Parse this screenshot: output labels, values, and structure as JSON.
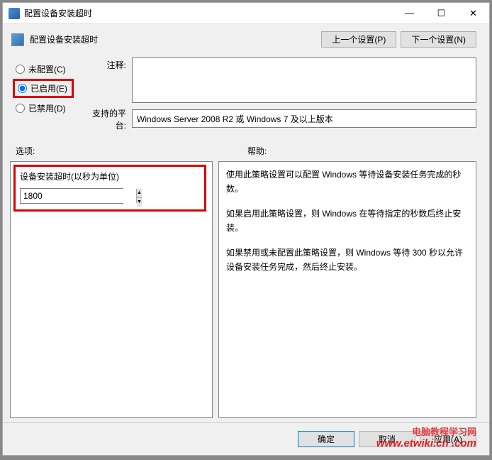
{
  "window": {
    "title": "配置设备安装超时"
  },
  "header": {
    "title": "配置设备安装超时",
    "prev": "上一个设置(P)",
    "next": "下一个设置(N)"
  },
  "radios": {
    "not_configured": "未配置(C)",
    "enabled": "已启用(E)",
    "disabled": "已禁用(D)"
  },
  "labels": {
    "comment": "注释:",
    "platform": "支持的平台:",
    "options": "选项:",
    "help": "帮助:"
  },
  "fields": {
    "comment_value": "",
    "platform_value": "Windows Server 2008 R2 或 Windows 7 及以上版本"
  },
  "options": {
    "timeout_label": "设备安装超时(以秒为单位)",
    "timeout_value": "1800"
  },
  "help": {
    "p1": "使用此策略设置可以配置 Windows 等待设备安装任务完成的秒数。",
    "p2": "如果启用此策略设置，则 Windows 在等待指定的秒数后终止安装。",
    "p3": "如果禁用或未配置此策略设置，则 Windows 等待 300 秒以允许设备安装任务完成，然后终止安装。"
  },
  "footer": {
    "ok": "确定",
    "cancel": "取消",
    "apply": "应用(A)"
  },
  "watermark": {
    "line1": "电脑教程学习网",
    "line2": "www.etwiki.cn .com"
  }
}
